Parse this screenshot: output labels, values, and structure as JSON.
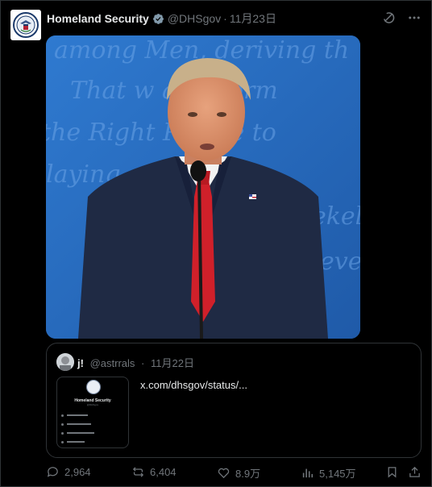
{
  "tweet": {
    "author_name": "Homeland Security",
    "author_handle": "@DHSgov",
    "separator": "·",
    "timestamp": "11月23日",
    "verified": true
  },
  "media": {
    "backdrop_text": [
      "among Men, deriving th",
      "That w  any Form",
      "the Right  People to",
      "laying  such",
      "ekely",
      "eve"
    ],
    "colors": {
      "backdrop": "#2a6cb8",
      "suit": "#1f2a44",
      "tie": "#d0202a"
    }
  },
  "quote": {
    "author_name": "j!",
    "author_handle": "@astrrals",
    "separator": "·",
    "timestamp": "11月22日",
    "link_text": "x.com/dhsgov/status/...",
    "thumb_title": "Homeland Security",
    "thumb_subtitle": "@DHSgov"
  },
  "actions": {
    "replies": "2,964",
    "reposts": "6,404",
    "likes": "8.9万",
    "views": "5,145万"
  },
  "icons": [
    "verified-badge-icon",
    "grok-icon",
    "more-icon",
    "reply-icon",
    "repost-icon",
    "like-icon",
    "views-icon",
    "bookmark-icon",
    "share-icon"
  ]
}
